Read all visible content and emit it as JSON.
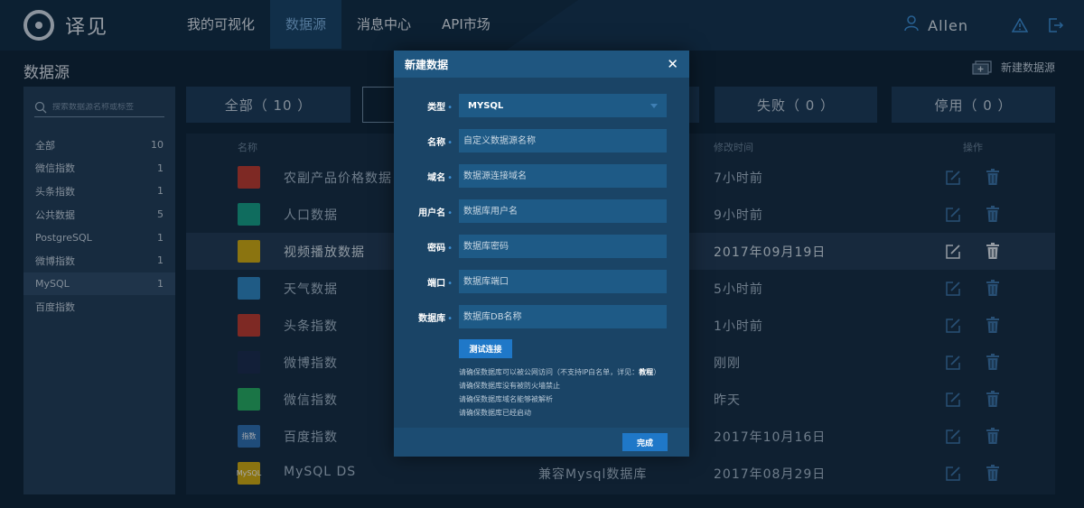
{
  "app": {
    "logo_text": "译见"
  },
  "nav": {
    "items": [
      {
        "label": "我的可视化"
      },
      {
        "label": "数据源"
      },
      {
        "label": "消息中心"
      },
      {
        "label": "API市场"
      }
    ]
  },
  "user": {
    "name": "Allen"
  },
  "page": {
    "title": "数据源",
    "new_source_label": "新建数据源"
  },
  "sidebar": {
    "search_placeholder": "搜索数据源名称或标签",
    "items": [
      {
        "label": "全部",
        "count": "10"
      },
      {
        "label": "微信指数",
        "count": "1"
      },
      {
        "label": "头条指数",
        "count": "1"
      },
      {
        "label": "公共数据",
        "count": "5"
      },
      {
        "label": "PostgreSQL",
        "count": "1"
      },
      {
        "label": "微博指数",
        "count": "1"
      },
      {
        "label": "MySQL",
        "count": "1"
      },
      {
        "label": "百度指数",
        "count": ""
      }
    ]
  },
  "filters": [
    {
      "label": "全部（ 10 ）"
    },
    {
      "label": ""
    },
    {
      "label": ""
    },
    {
      "label": "失败（ 0 ）"
    },
    {
      "label": "停用（ 0 ）"
    }
  ],
  "table": {
    "headers": {
      "name": "名称",
      "modified": "修改时间",
      "actions": "操作"
    },
    "rows": [
      {
        "name": "农副产品价格数据",
        "desc": "",
        "time": "7小时前",
        "icon": "agri-icon",
        "color": "#c0392b"
      },
      {
        "name": "人口数据",
        "desc": "",
        "time": "9小时前",
        "icon": "population-icon",
        "color": "#16a085"
      },
      {
        "name": "视频播放数据",
        "desc": "",
        "time": "2017年09月19日",
        "icon": "video-icon",
        "color": "#d4ac0d"
      },
      {
        "name": "天气数据",
        "desc": "",
        "time": "5小时前",
        "icon": "weather-icon",
        "color": "#2e86c1"
      },
      {
        "name": "头条指数",
        "desc": "",
        "time": "1小时前",
        "icon": "toutiao-icon",
        "color": "#c0392b"
      },
      {
        "name": "微博指数",
        "desc": "",
        "time": "刚刚",
        "icon": "weibo-icon",
        "color": "#1b2a4a"
      },
      {
        "name": "微信指数",
        "desc": "",
        "time": "昨天",
        "icon": "wechat-icon",
        "color": "#27ae60"
      },
      {
        "name": "百度指数",
        "desc": "",
        "time": "2017年10月16日",
        "icon": "baidu-icon",
        "color": "#2e6fb0",
        "icon_text": "指数"
      },
      {
        "name": "MySQL DS",
        "desc": "兼容Mysql数据库",
        "time": "2017年08月29日",
        "icon": "mysql-icon",
        "color": "#d4ac0d",
        "icon_text": "MySQL"
      }
    ]
  },
  "modal": {
    "title": "新建数据",
    "close": "✕",
    "fields": [
      {
        "label": "类型",
        "value": "MYSQL",
        "type": "select"
      },
      {
        "label": "名称",
        "placeholder": "自定义数据源名称"
      },
      {
        "label": "域名",
        "placeholder": "数据源连接域名"
      },
      {
        "label": "用户名",
        "placeholder": "数据库用户名"
      },
      {
        "label": "密码",
        "placeholder": "数据库密码"
      },
      {
        "label": "端口",
        "placeholder": "数据库端口"
      },
      {
        "label": "数据库",
        "placeholder": "数据库DB名称"
      }
    ],
    "test_button": "测试连接",
    "tips": [
      "请确保数据库可以被公网访问（不支持IP白名单，详见：",
      "教程",
      "）",
      "请确保数据库没有被防火墙禁止",
      "请确保数据库域名能够被解析",
      "请确保数据库已经启动"
    ],
    "done_button": "完成"
  },
  "colors": {
    "accent": "#1f78c8",
    "background": "#0f2233",
    "modal": "#1a4466"
  }
}
